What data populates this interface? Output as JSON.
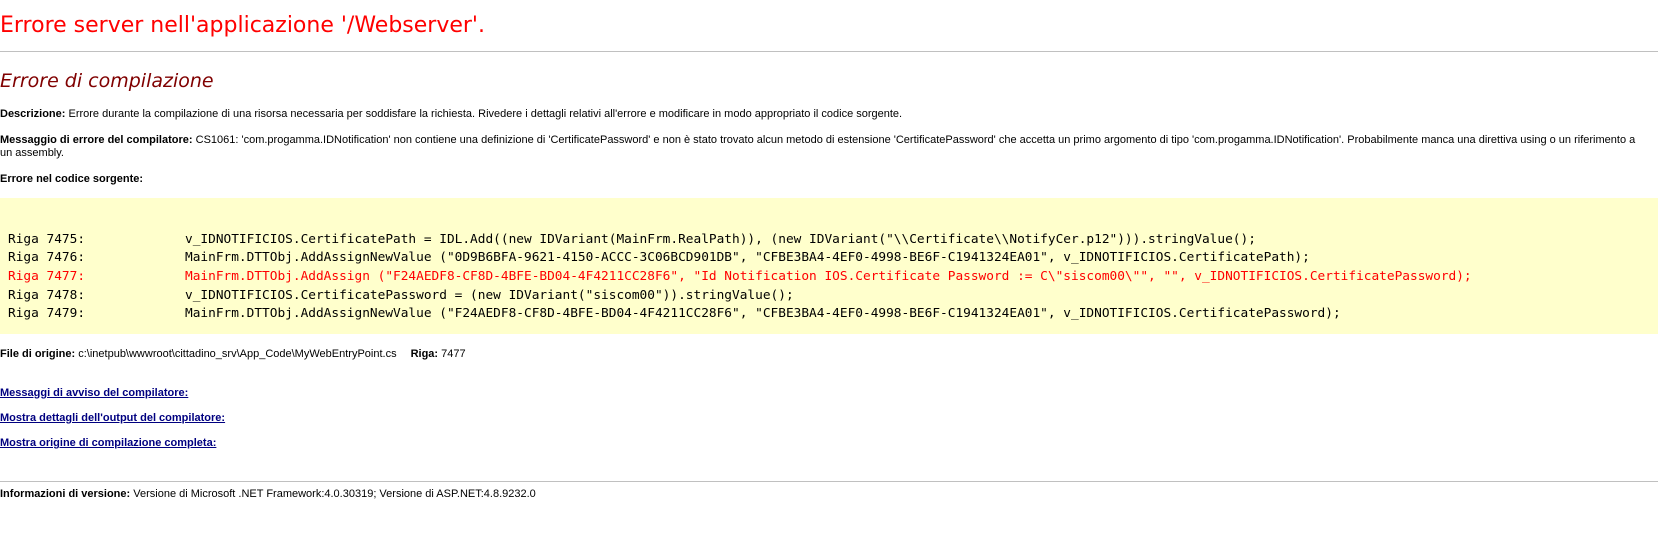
{
  "header": {
    "title": "Errore server nell'applicazione '/Webserver'."
  },
  "error": {
    "title": "Errore di compilazione",
    "description_label": "Descrizione:",
    "description_text": "Errore durante la compilazione di una risorsa necessaria per soddisfare la richiesta. Rivedere i dettagli relativi all'errore e modificare in modo appropriato il codice sorgente.",
    "compiler_message_label": "Messaggio di errore del compilatore:",
    "compiler_message_text": "CS1061: 'com.progamma.IDNotification' non contiene una definizione di 'CertificatePassword' e non è stato trovato alcun metodo di estensione 'CertificatePassword' che accetta un primo argomento di tipo 'com.progamma.IDNotification'. Probabilmente manca una direttiva using o un riferimento a un assembly.",
    "source_error_label": "Errore nel codice sorgente:"
  },
  "source_code": {
    "lines": [
      {
        "label": "Riga 7475:",
        "code": "v_IDNOTIFICIOS.CertificatePath = IDL.Add((new IDVariant(MainFrm.RealPath)), (new IDVariant(\"\\\\Certificate\\\\NotifyCer.p12\"))).stringValue();",
        "highlighted": false
      },
      {
        "label": "Riga 7476:",
        "code": "MainFrm.DTTObj.AddAssignNewValue (\"0D9B6BFA-9621-4150-ACCC-3C06BCD901DB\", \"CFBE3BA4-4EF0-4998-BE6F-C1941324EA01\", v_IDNOTIFICIOS.CertificatePath);",
        "highlighted": false
      },
      {
        "label": "Riga 7477:",
        "code": "MainFrm.DTTObj.AddAssign (\"F24AEDF8-CF8D-4BFE-BD04-4F4211CC28F6\", \"Id Notification IOS.Certificate Password := C\\\"siscom00\\\"\", \"\", v_IDNOTIFICIOS.CertificatePassword);",
        "highlighted": true
      },
      {
        "label": "Riga 7478:",
        "code": "v_IDNOTIFICIOS.CertificatePassword = (new IDVariant(\"siscom00\")).stringValue();",
        "highlighted": false
      },
      {
        "label": "Riga 7479:",
        "code": "MainFrm.DTTObj.AddAssignNewValue (\"F24AEDF8-CF8D-4BFE-BD04-4F4211CC28F6\", \"CFBE3BA4-4EF0-4998-BE6F-C1941324EA01\", v_IDNOTIFICIOS.CertificatePassword);",
        "highlighted": false
      }
    ],
    "highlight_color": "#ff0000",
    "background_color": "#ffffcc"
  },
  "source_file": {
    "label": "File di origine:",
    "path": "c:\\inetpub\\wwwroot\\cittadino_srv\\App_Code\\MyWebEntryPoint.cs",
    "line_label": "Riga:",
    "line_number": "7477"
  },
  "links": {
    "warnings": "Messaggi di avviso del compilatore:",
    "output": "Mostra dettagli dell'output del compilatore:",
    "full_source": "Mostra origine di compilazione completa:"
  },
  "version": {
    "label": "Informazioni di versione:",
    "text": "Versione di Microsoft .NET Framework:4.0.30319; Versione di ASP.NET:4.8.9232.0"
  },
  "colors": {
    "title": "#ff0000",
    "section_title": "#800000",
    "link": "#000080"
  }
}
